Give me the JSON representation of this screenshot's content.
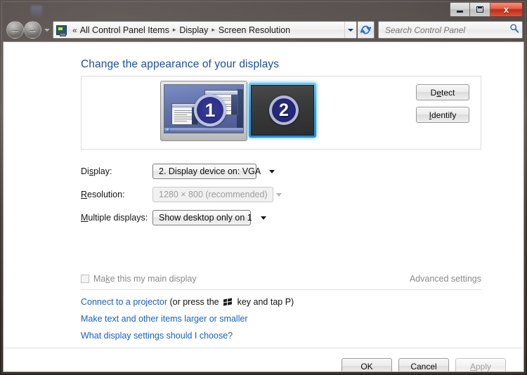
{
  "window": {
    "title": "",
    "controls": {
      "minimize_label": "Minimize",
      "maximize_label": "Maximize",
      "close_label": "x"
    }
  },
  "nav": {
    "back_label": "←",
    "forward_label": "→",
    "recent_pages_label": "Recent pages",
    "breadcrumb": {
      "leading_separator": "«",
      "items": [
        "All Control Panel Items",
        "Display",
        "Screen Resolution"
      ],
      "separator": "▸"
    },
    "refresh_label": "Refresh",
    "address_dropdown_label": "Previous locations"
  },
  "search": {
    "placeholder": "Search Control Panel",
    "value": "",
    "icon": "search-icon"
  },
  "main": {
    "heading": "Change the appearance of your displays",
    "preview": {
      "monitors": [
        {
          "number": "1",
          "selected": false,
          "state": "active-desktop"
        },
        {
          "number": "2",
          "selected": true,
          "state": "blank"
        }
      ],
      "detect_button": {
        "prefix": "D",
        "accel": "e",
        "suffix": "tect",
        "full": "Detect"
      },
      "identify_button": {
        "accel": "I",
        "suffix": "dentify",
        "full": "Identify"
      }
    },
    "fields": [
      {
        "label_prefix": "Di",
        "label_accel": "s",
        "label_suffix": "play:",
        "label_full": "Display:",
        "value": "2. Display device on: VGA",
        "disabled": false
      },
      {
        "label_prefix": "",
        "label_accel": "R",
        "label_suffix": "esolution:",
        "label_full": "Resolution:",
        "value": "1280 × 800 (recommended)",
        "disabled": true
      },
      {
        "label_prefix": "",
        "label_accel": "M",
        "label_suffix": "ultiple displays:",
        "label_full": "Multiple displays:",
        "value": "Show desktop only on 1",
        "disabled": false
      }
    ],
    "main_display_checkbox": {
      "label_prefix": "Ma",
      "label_accel": "k",
      "label_suffix": "e this my main display",
      "label_full": "Make this my main display",
      "checked": false,
      "disabled": true
    },
    "advanced_settings_link": "Advanced settings",
    "links": {
      "projector_link": "Connect to a projector",
      "projector_text_before": " (or press the ",
      "projector_text_after": " key and tap P)",
      "text_size_link": "Make text and other items larger or smaller",
      "what_choose_link": "What display settings should I choose?"
    }
  },
  "footer": {
    "ok_label": "OK",
    "cancel_label": "Cancel",
    "apply": {
      "accel": "A",
      "suffix": "pply",
      "full": "Apply",
      "disabled": true
    }
  },
  "colors": {
    "heading_blue": "#1b50a0",
    "link_blue": "#1660c8",
    "selection_blue": "#2f9fe8",
    "disabled_gray": "#9d9d9d",
    "close_red": "#bf2c18"
  }
}
